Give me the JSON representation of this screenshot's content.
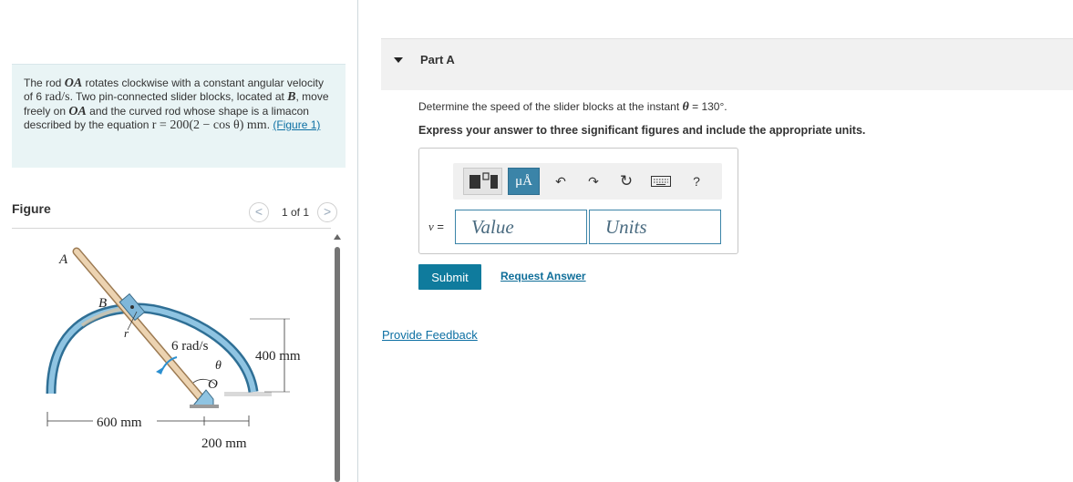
{
  "problem": {
    "t1": "The rod ",
    "m1": "OA",
    "t2": " rotates clockwise with a constant angular velocity of 6 ",
    "m2": "rad/s",
    "t3": ". Two pin-connected slider blocks, located at ",
    "m3": "B",
    "t4": ", move freely on ",
    "m4": "OA",
    "t5": " and the curved rod whose shape is a limacon described by the equation ",
    "eq": "r = 200(2 − cos θ) mm",
    "t6": ". ",
    "link": "(Figure 1)"
  },
  "figure_panel": {
    "title": "Figure",
    "pager": "1 of 1",
    "prev_glyph": "<",
    "next_glyph": ">"
  },
  "figure": {
    "label_A": "A",
    "label_B": "B",
    "label_r": "r",
    "label_omega": "6 rad/s",
    "label_theta": "θ",
    "label_O": "O",
    "dim_height": "400 mm",
    "dim_left": "600 mm",
    "dim_right": "200 mm"
  },
  "part": {
    "title": "Part A",
    "q_text": "Determine the speed of the slider blocks at the instant ",
    "q_var": "θ",
    "q_value": " = 130°.",
    "instruction": "Express your answer to three significant figures and include the appropriate units."
  },
  "toolbar": {
    "units_label": "μÅ",
    "undo_glyph": "↶",
    "redo_glyph": "↷",
    "reset_glyph": "↻",
    "help_label": "?"
  },
  "answer": {
    "var": "v",
    "eq": " =",
    "value_placeholder": "Value",
    "units_placeholder": "Units"
  },
  "actions": {
    "submit": "Submit",
    "request": "Request Answer",
    "feedback": "Provide Feedback"
  },
  "colors": {
    "accent": "#0f7b9d",
    "problem_bg": "#e9f4f5",
    "link": "#0c6fa3",
    "rod": "#e7c9a6",
    "curve": "#3e8dbc"
  }
}
